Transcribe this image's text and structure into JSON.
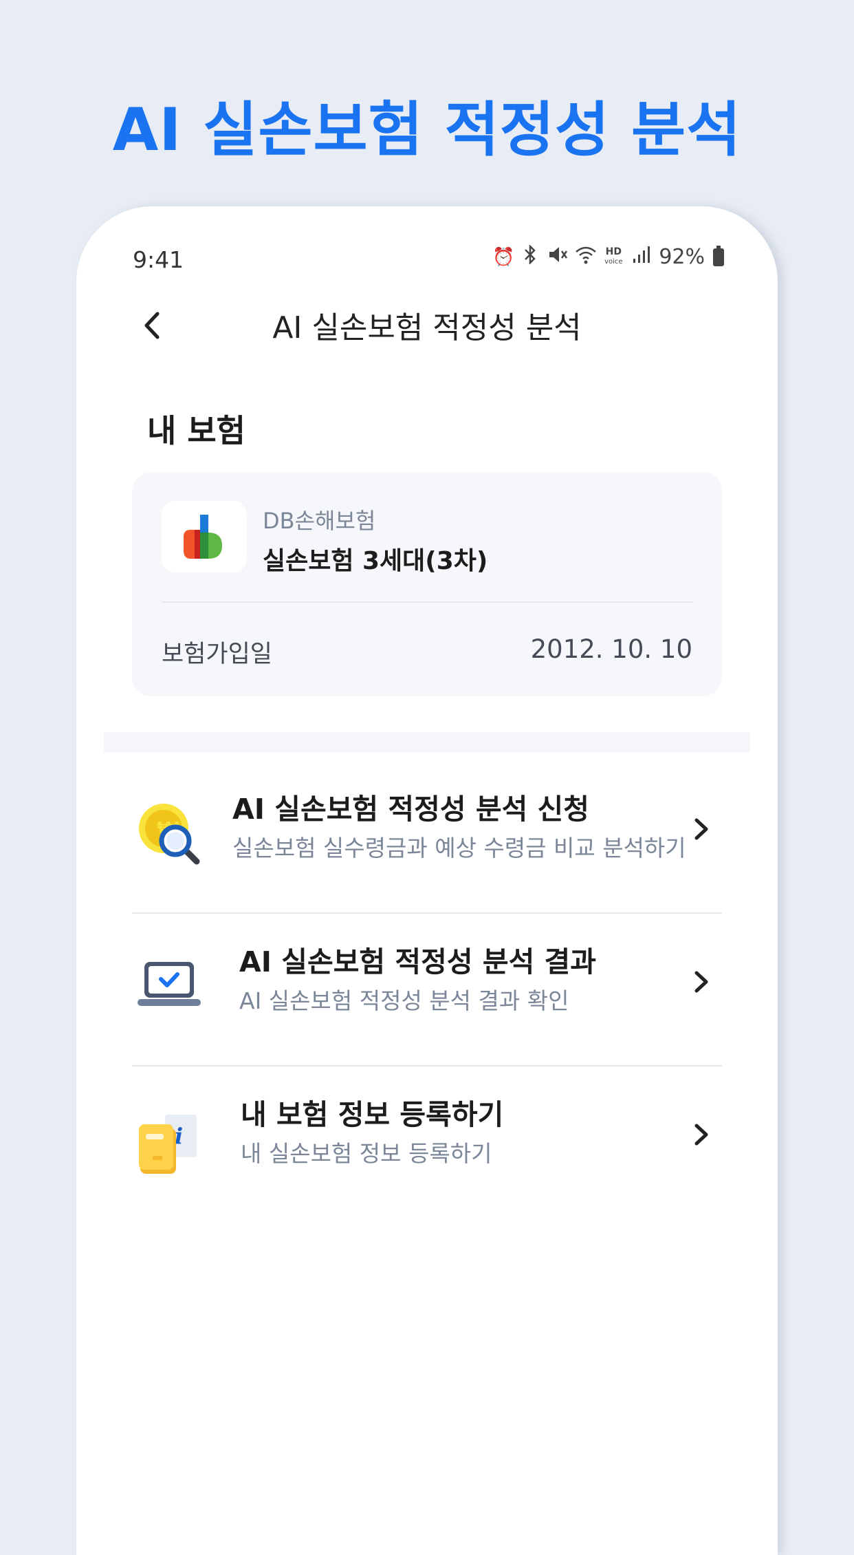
{
  "promo": {
    "title": "AI 실손보험 적정성 분석"
  },
  "status_bar": {
    "time": "9:41",
    "icons": [
      "alarm-icon",
      "bluetooth-icon",
      "mute-icon",
      "wifi-icon",
      "hd-voice-icon",
      "signal-icon",
      "battery-icon"
    ],
    "hd_label": "HD",
    "voice_label": "voice",
    "battery": "92%"
  },
  "header": {
    "title": "AI 실손보험 적정성 분석",
    "back_icon": "chevron-left-icon"
  },
  "my_insurance": {
    "section_title": "내 보험",
    "company": "DB손해보험",
    "product": "실손보험 3세대(3차)",
    "join_label": "보험가입일",
    "join_date": "2012. 10. 10"
  },
  "menu": [
    {
      "title": "AI 실손보험 적정성 분석 신청",
      "subtitle": "실손보험 실수령금과 예상 수령금 비교 분석하기",
      "icon": "coin-magnifier-icon"
    },
    {
      "title": "AI 실손보험 적정성 분석 결과",
      "subtitle": "AI 실손보험 적정성 분석 결과 확인",
      "icon": "laptop-check-icon"
    },
    {
      "title": "내 보험 정보 등록하기",
      "subtitle": "내 실손보험 정보 등록하기",
      "icon": "document-info-icon"
    }
  ],
  "colors": {
    "accent": "#1a73f0",
    "background": "#e8edf5",
    "card": "#f6f7fb"
  }
}
